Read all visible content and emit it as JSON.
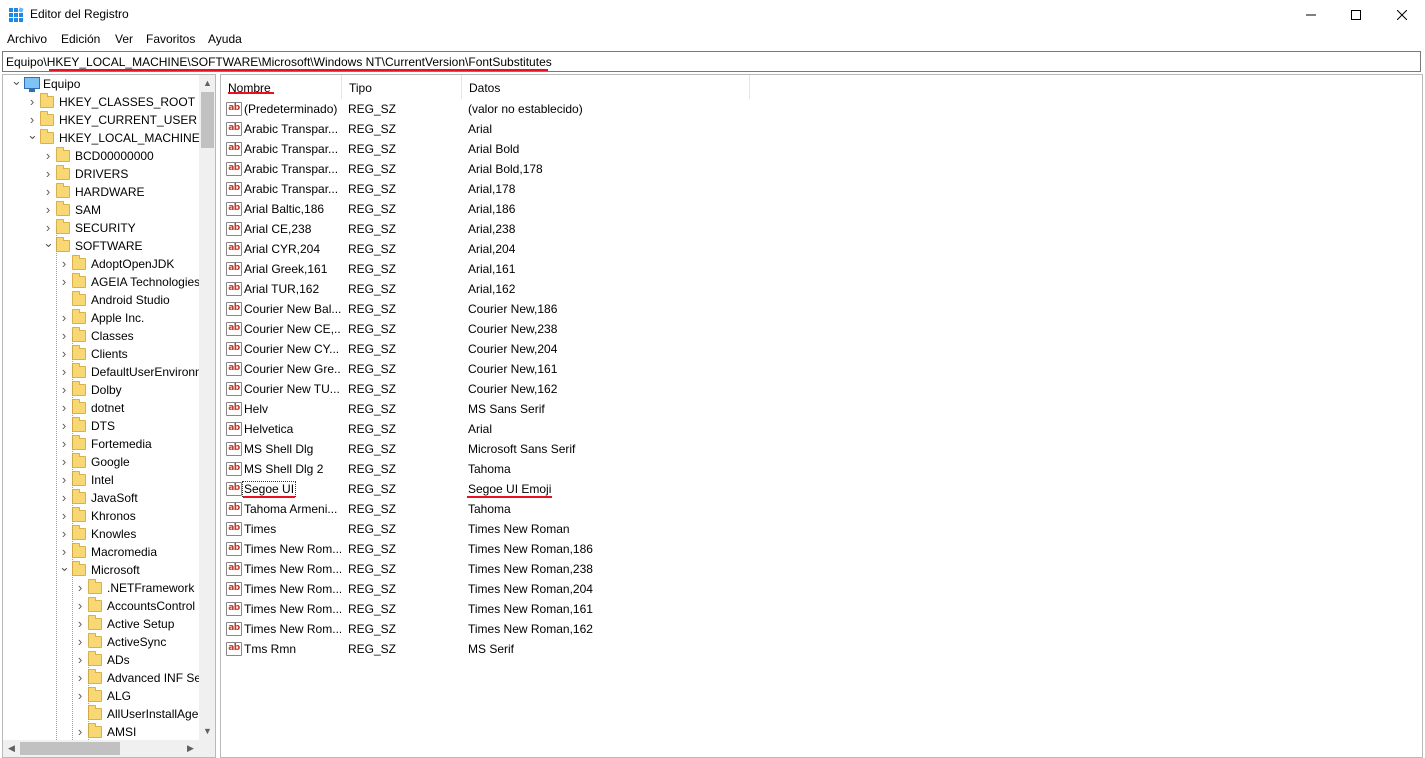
{
  "window": {
    "title": "Editor del Registro"
  },
  "menu": [
    "Archivo",
    "Edición",
    "Ver",
    "Favoritos",
    "Ayuda"
  ],
  "address": "Equipo\\HKEY_LOCAL_MACHINE\\SOFTWARE\\Microsoft\\Windows NT\\CurrentVersion\\FontSubstitutes",
  "tree": [
    {
      "label": "Equipo",
      "level": 0,
      "expanded": true,
      "icon": "computer-icon"
    },
    {
      "label": "HKEY_CLASSES_ROOT",
      "level": 1,
      "expanded": false
    },
    {
      "label": "HKEY_CURRENT_USER",
      "level": 1,
      "expanded": false
    },
    {
      "label": "HKEY_LOCAL_MACHINE",
      "level": 1,
      "expanded": true
    },
    {
      "label": "BCD00000000",
      "level": 2,
      "expanded": false
    },
    {
      "label": "DRIVERS",
      "level": 2,
      "expanded": false
    },
    {
      "label": "HARDWARE",
      "level": 2,
      "expanded": false
    },
    {
      "label": "SAM",
      "level": 2,
      "expanded": false
    },
    {
      "label": "SECURITY",
      "level": 2,
      "expanded": false
    },
    {
      "label": "SOFTWARE",
      "level": 2,
      "expanded": true
    },
    {
      "label": "AdoptOpenJDK",
      "level": 3,
      "expanded": false
    },
    {
      "label": "AGEIA Technologies",
      "level": 3,
      "expanded": false
    },
    {
      "label": "Android Studio",
      "level": 3,
      "expanded": null
    },
    {
      "label": "Apple Inc.",
      "level": 3,
      "expanded": false
    },
    {
      "label": "Classes",
      "level": 3,
      "expanded": false
    },
    {
      "label": "Clients",
      "level": 3,
      "expanded": false
    },
    {
      "label": "DefaultUserEnvironn",
      "level": 3,
      "expanded": false
    },
    {
      "label": "Dolby",
      "level": 3,
      "expanded": false
    },
    {
      "label": "dotnet",
      "level": 3,
      "expanded": false
    },
    {
      "label": "DTS",
      "level": 3,
      "expanded": false
    },
    {
      "label": "Fortemedia",
      "level": 3,
      "expanded": false
    },
    {
      "label": "Google",
      "level": 3,
      "expanded": false
    },
    {
      "label": "Intel",
      "level": 3,
      "expanded": false
    },
    {
      "label": "JavaSoft",
      "level": 3,
      "expanded": false
    },
    {
      "label": "Khronos",
      "level": 3,
      "expanded": false
    },
    {
      "label": "Knowles",
      "level": 3,
      "expanded": false
    },
    {
      "label": "Macromedia",
      "level": 3,
      "expanded": false
    },
    {
      "label": "Microsoft",
      "level": 3,
      "expanded": true
    },
    {
      "label": ".NETFramework",
      "level": 4,
      "expanded": false
    },
    {
      "label": "AccountsControl",
      "level": 4,
      "expanded": false
    },
    {
      "label": "Active Setup",
      "level": 4,
      "expanded": false
    },
    {
      "label": "ActiveSync",
      "level": 4,
      "expanded": false
    },
    {
      "label": "ADs",
      "level": 4,
      "expanded": false
    },
    {
      "label": "Advanced INF Set",
      "level": 4,
      "expanded": false
    },
    {
      "label": "ALG",
      "level": 4,
      "expanded": false
    },
    {
      "label": "AllUserInstallAger",
      "level": 4,
      "expanded": null
    },
    {
      "label": "AMSI",
      "level": 4,
      "expanded": false
    }
  ],
  "columns": {
    "name": "Nombre",
    "type": "Tipo",
    "data": "Datos"
  },
  "values": [
    {
      "name": "(Predeterminado)",
      "type": "REG_SZ",
      "data": "(valor no establecido)"
    },
    {
      "name": "Arabic Transpar...",
      "type": "REG_SZ",
      "data": "Arial"
    },
    {
      "name": "Arabic Transpar...",
      "type": "REG_SZ",
      "data": "Arial Bold"
    },
    {
      "name": "Arabic Transpar...",
      "type": "REG_SZ",
      "data": "Arial Bold,178"
    },
    {
      "name": "Arabic Transpar...",
      "type": "REG_SZ",
      "data": "Arial,178"
    },
    {
      "name": "Arial Baltic,186",
      "type": "REG_SZ",
      "data": "Arial,186"
    },
    {
      "name": "Arial CE,238",
      "type": "REG_SZ",
      "data": "Arial,238"
    },
    {
      "name": "Arial CYR,204",
      "type": "REG_SZ",
      "data": "Arial,204"
    },
    {
      "name": "Arial Greek,161",
      "type": "REG_SZ",
      "data": "Arial,161"
    },
    {
      "name": "Arial TUR,162",
      "type": "REG_SZ",
      "data": "Arial,162"
    },
    {
      "name": "Courier New Bal...",
      "type": "REG_SZ",
      "data": "Courier New,186"
    },
    {
      "name": "Courier New CE,...",
      "type": "REG_SZ",
      "data": "Courier New,238"
    },
    {
      "name": "Courier New CY...",
      "type": "REG_SZ",
      "data": "Courier New,204"
    },
    {
      "name": "Courier New Gre...",
      "type": "REG_SZ",
      "data": "Courier New,161"
    },
    {
      "name": "Courier New TU...",
      "type": "REG_SZ",
      "data": "Courier New,162"
    },
    {
      "name": "Helv",
      "type": "REG_SZ",
      "data": "MS Sans Serif"
    },
    {
      "name": "Helvetica",
      "type": "REG_SZ",
      "data": "Arial"
    },
    {
      "name": "MS Shell Dlg",
      "type": "REG_SZ",
      "data": "Microsoft Sans Serif"
    },
    {
      "name": "MS Shell Dlg 2",
      "type": "REG_SZ",
      "data": "Tahoma"
    },
    {
      "name": "Segoe UI",
      "type": "REG_SZ",
      "data": "Segoe UI Emoji",
      "selected": true
    },
    {
      "name": "Tahoma Armeni...",
      "type": "REG_SZ",
      "data": "Tahoma"
    },
    {
      "name": "Times",
      "type": "REG_SZ",
      "data": "Times New Roman"
    },
    {
      "name": "Times New Rom...",
      "type": "REG_SZ",
      "data": "Times New Roman,186"
    },
    {
      "name": "Times New Rom...",
      "type": "REG_SZ",
      "data": "Times New Roman,238"
    },
    {
      "name": "Times New Rom...",
      "type": "REG_SZ",
      "data": "Times New Roman,204"
    },
    {
      "name": "Times New Rom...",
      "type": "REG_SZ",
      "data": "Times New Roman,161"
    },
    {
      "name": "Times New Rom...",
      "type": "REG_SZ",
      "data": "Times New Roman,162"
    },
    {
      "name": "Tms Rmn",
      "type": "REG_SZ",
      "data": "MS Serif"
    }
  ],
  "colors": {
    "highlight": "#e81123",
    "folder": "#f8d775"
  }
}
